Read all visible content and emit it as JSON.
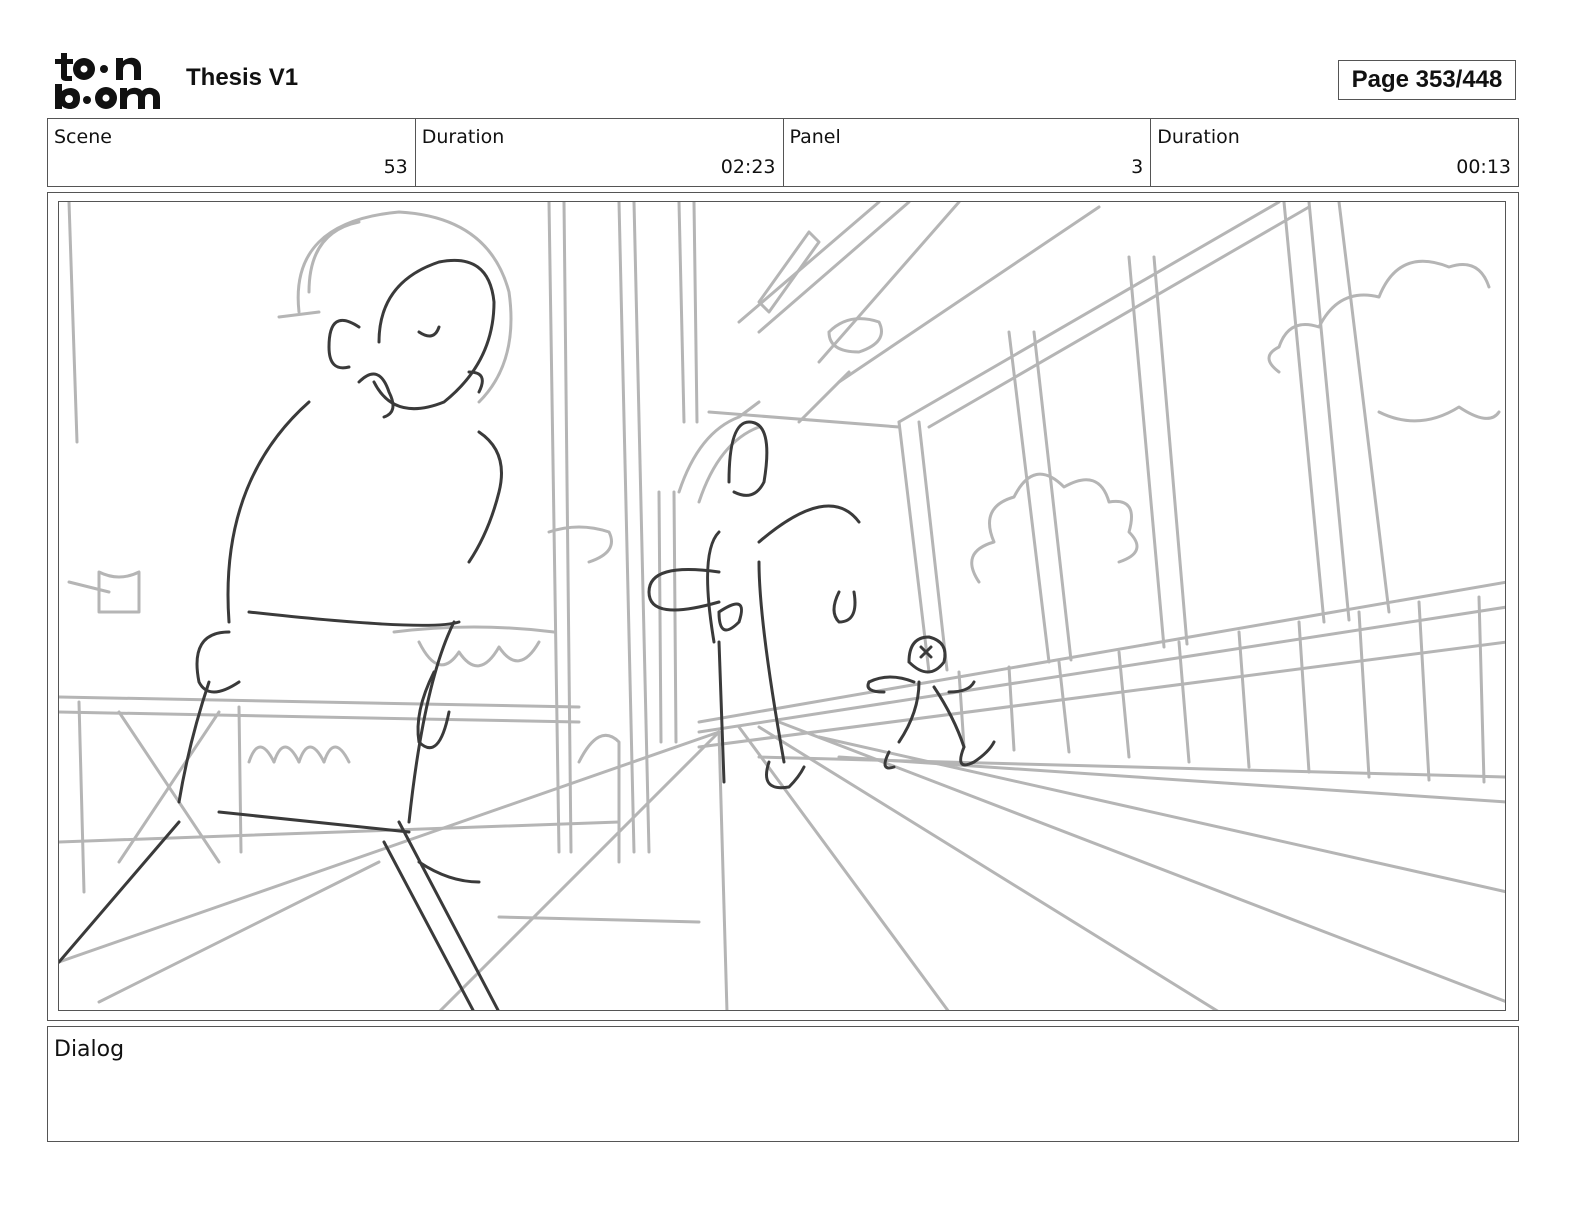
{
  "header": {
    "logo_name": "toon-boom-logo",
    "title": "Thesis V1",
    "page": "Page 353/448"
  },
  "info": {
    "scene_label": "Scene",
    "scene_value": "53",
    "scene_duration_label": "Duration",
    "scene_duration_value": "02:23",
    "panel_label": "Panel",
    "panel_value": "3",
    "panel_duration_label": "Duration",
    "panel_duration_value": "00:13"
  },
  "dialog": {
    "label": "Dialog"
  },
  "colors": {
    "sketch_dark": "#3a3a3a",
    "sketch_light": "#b5b5b5",
    "border": "#555555"
  }
}
